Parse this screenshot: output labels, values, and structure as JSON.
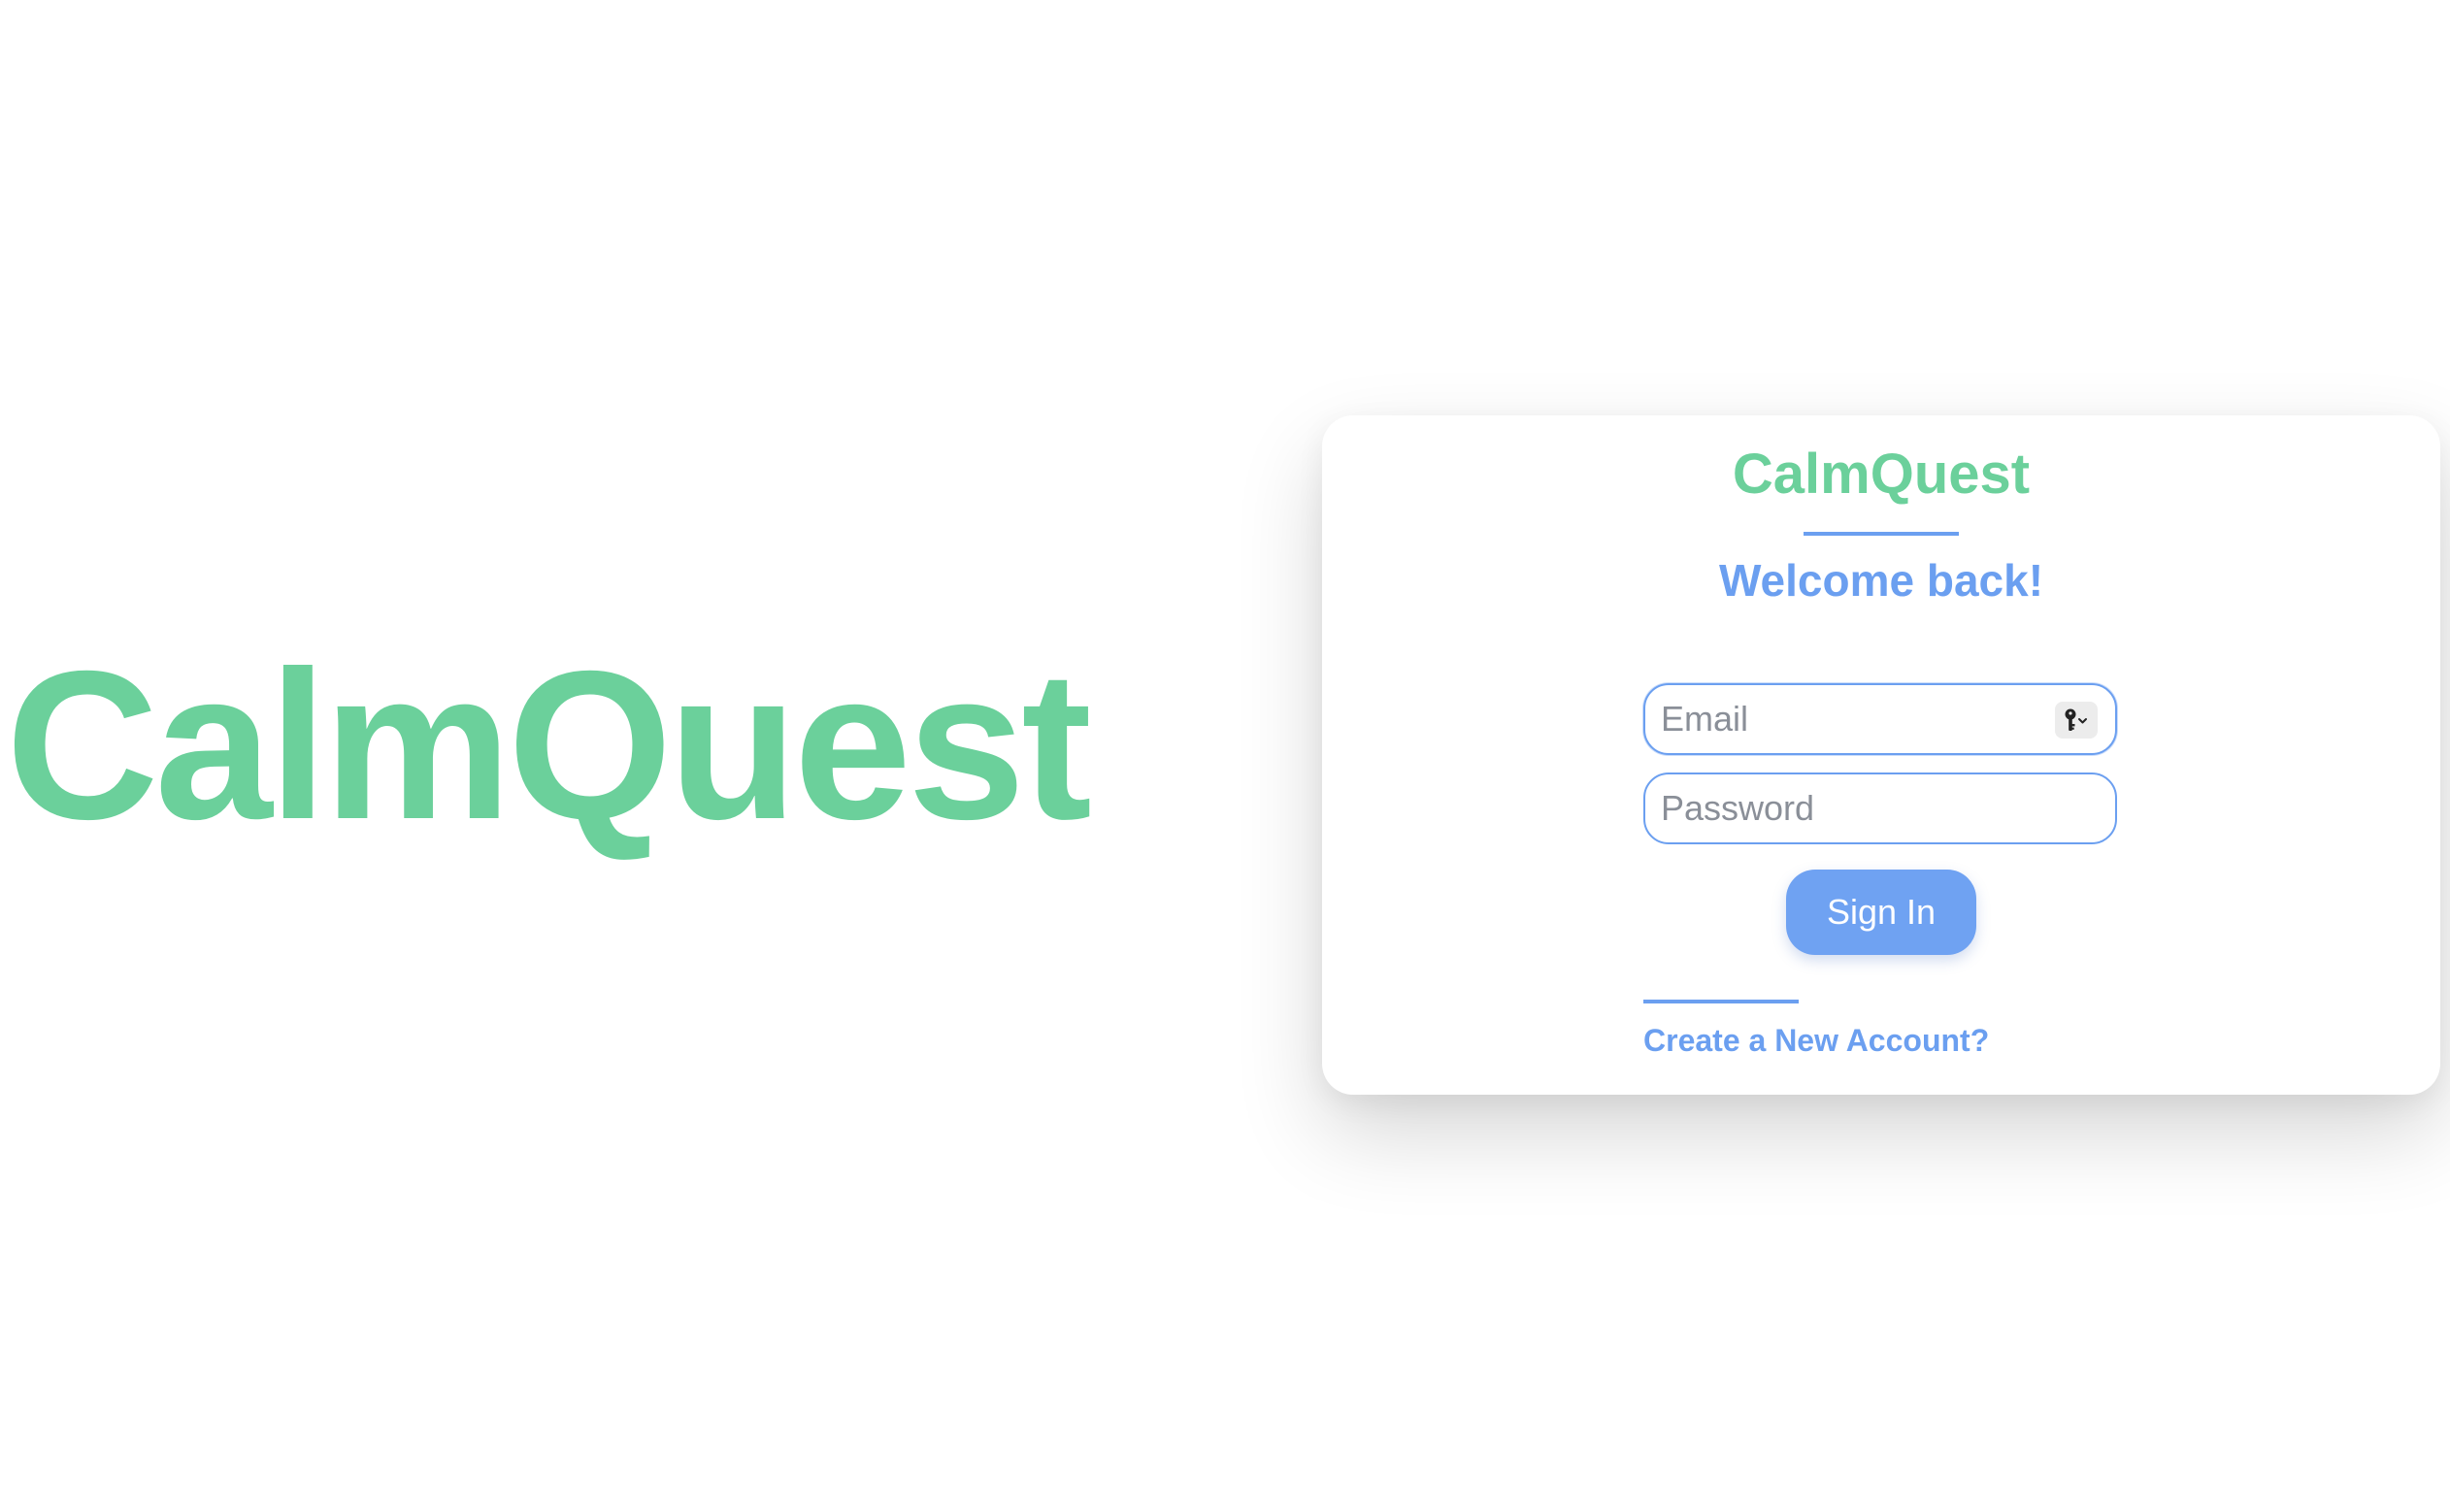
{
  "hero": {
    "title": "CalmQuest"
  },
  "card": {
    "brand": "CalmQuest",
    "welcome": "Welcome back!",
    "email": {
      "placeholder": "Email",
      "value": "",
      "autofill_icon": "key-icon"
    },
    "password": {
      "placeholder": "Password",
      "value": ""
    },
    "signin_label": "Sign In",
    "create_account_label": "Create a New Account?"
  },
  "colors": {
    "brand_green": "#6bd09b",
    "accent_blue": "#6b9ff0",
    "button_blue": "#6fa2f2",
    "background": "#ffffff"
  }
}
